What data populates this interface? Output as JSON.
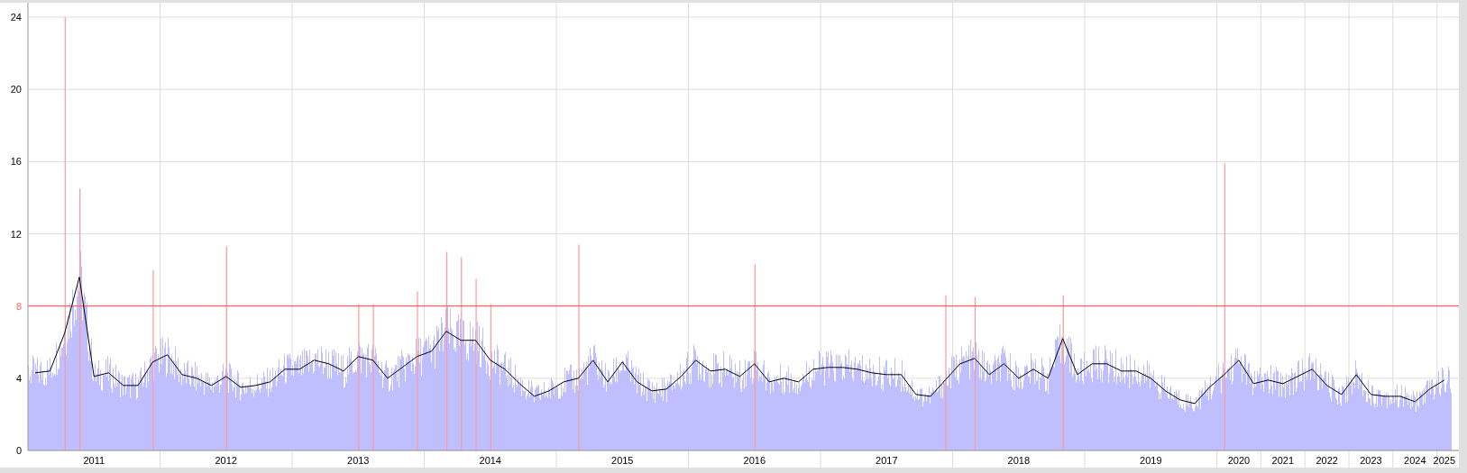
{
  "chart_data": {
    "type": "line",
    "grid": true,
    "ylim": [
      0,
      24
    ],
    "yticks": [
      0,
      4,
      8,
      12,
      16,
      20,
      24
    ],
    "categories": [
      null,
      null,
      null,
      null,
      "2011",
      null,
      null,
      null,
      null,
      null,
      null,
      null,
      null,
      "2012",
      null,
      null,
      null,
      null,
      null,
      null,
      null,
      null,
      "2013",
      null,
      null,
      null,
      null,
      null,
      null,
      null,
      null,
      "2014",
      null,
      null,
      null,
      null,
      null,
      null,
      null,
      null,
      "2015",
      null,
      null,
      null,
      null,
      null,
      null,
      null,
      null,
      "2016",
      null,
      null,
      null,
      null,
      null,
      null,
      null,
      null,
      "2017",
      null,
      null,
      null,
      null,
      null,
      null,
      null,
      null,
      "2018",
      null,
      null,
      null,
      null,
      null,
      null,
      null,
      null,
      "2019",
      null,
      null,
      null,
      null,
      null,
      "2020",
      null,
      null,
      "2021",
      null,
      null,
      "2022",
      null,
      null,
      "2023",
      null,
      null,
      "2024",
      null,
      "2025"
    ],
    "series": [
      {
        "type": "line",
        "color": "#000000",
        "values": [
          4.3,
          4.4,
          6.5,
          9.6,
          4.1,
          4.3,
          3.6,
          3.6,
          4.9,
          5.3,
          4.2,
          4.0,
          3.6,
          4.1,
          3.5,
          3.6,
          3.8,
          4.5,
          4.5,
          5.0,
          4.8,
          4.4,
          5.2,
          5.0,
          4.0,
          4.6,
          5.2,
          5.5,
          6.6,
          6.1,
          6.1,
          5.0,
          4.5,
          3.7,
          3.0,
          3.3,
          3.8,
          4.0,
          5.0,
          3.8,
          4.9,
          3.8,
          3.3,
          3.4,
          4.1,
          5.0,
          4.4,
          4.5,
          4.1,
          4.8,
          3.8,
          4.0,
          3.8,
          4.5,
          4.6,
          4.6,
          4.5,
          4.3,
          4.2,
          4.2,
          3.1,
          3.0,
          3.9,
          4.8,
          5.1,
          4.2,
          4.8,
          4.0,
          4.5,
          4.0,
          6.2,
          4.2,
          4.8,
          4.8,
          4.4,
          4.4,
          4.0,
          3.3,
          2.8,
          2.6,
          3.5,
          4.2,
          5.0,
          3.7,
          3.9,
          3.7,
          4.1,
          4.5,
          3.6,
          3.1,
          4.2,
          3.1,
          3.0,
          3.0,
          2.7,
          3.4,
          3.9
        ]
      },
      {
        "type": "bar",
        "color": "#ff9999",
        "values": [
          null,
          null,
          24,
          14.5,
          null,
          null,
          null,
          null,
          10,
          null,
          null,
          null,
          null,
          11.3,
          null,
          null,
          null,
          null,
          null,
          null,
          null,
          null,
          8.1,
          8.1,
          null,
          null,
          8.8,
          null,
          11,
          10.7,
          9.5,
          8.1,
          null,
          null,
          null,
          null,
          null,
          11.4,
          null,
          null,
          null,
          null,
          null,
          null,
          null,
          null,
          null,
          null,
          null,
          10.3,
          null,
          null,
          null,
          null,
          null,
          null,
          null,
          null,
          null,
          null,
          null,
          null,
          8.6,
          null,
          8.5,
          null,
          null,
          null,
          null,
          null,
          8.6,
          null,
          null,
          null,
          null,
          null,
          null,
          null,
          null,
          null,
          null,
          15.9,
          null,
          null,
          null,
          null,
          null,
          null,
          null,
          null,
          null,
          null,
          null,
          null,
          null,
          null,
          null
        ]
      }
    ],
    "ref_lines": [
      {
        "axis": "y",
        "value": 8,
        "color": "#ff6666"
      }
    ]
  }
}
